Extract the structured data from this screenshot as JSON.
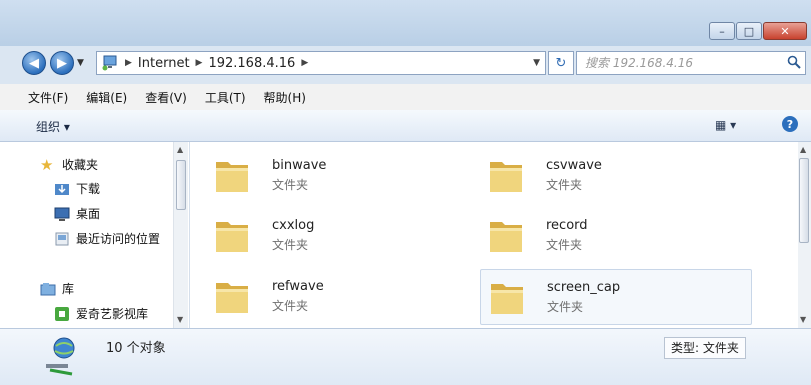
{
  "window": {
    "controls": {
      "minimize": "–",
      "maximize": "□",
      "close": "✕"
    }
  },
  "nav": {
    "address": {
      "crumbs": [
        "Internet",
        "192.168.4.16"
      ]
    },
    "search": {
      "placeholder": "搜索 192.168.4.16"
    }
  },
  "menubar": {
    "items": [
      "文件(F)",
      "编辑(E)",
      "查看(V)",
      "工具(T)",
      "帮助(H)"
    ]
  },
  "toolbar": {
    "organize_label": "组织 ▾",
    "view_label": "▾"
  },
  "sidebar": {
    "favorites_label": "收藏夹",
    "items": [
      "下载",
      "桌面",
      "最近访问的位置"
    ],
    "library_label": "库",
    "library_items": [
      "爱奇艺影视库"
    ]
  },
  "folders": [
    {
      "name": "binwave",
      "type": "文件夹"
    },
    {
      "name": "csvwave",
      "type": "文件夹"
    },
    {
      "name": "cxxlog",
      "type": "文件夹"
    },
    {
      "name": "record",
      "type": "文件夹"
    },
    {
      "name": "refwave",
      "type": "文件夹"
    },
    {
      "name": "screen_cap",
      "type": "文件夹"
    }
  ],
  "status": {
    "count": "10 个对象",
    "type_badge": "类型: 文件夹"
  },
  "colors": {
    "folder": "#e7c566",
    "accent": "#2c6fbd"
  }
}
